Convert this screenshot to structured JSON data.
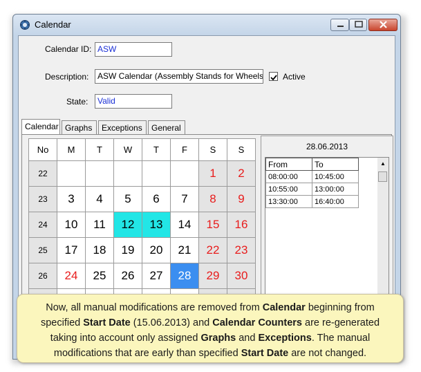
{
  "window": {
    "title": "Calendar"
  },
  "form": {
    "calendar_id_label": "Calendar ID:",
    "calendar_id_value": "ASW",
    "description_label": "Description:",
    "description_value": "ASW Calendar (Assembly Stands for Wheels)",
    "active_label": "Active",
    "active_checked": true,
    "state_label": "State:",
    "state_value": "Valid"
  },
  "tabs": [
    "Calendar",
    "Graphs",
    "Exceptions",
    "General"
  ],
  "calendar": {
    "headers": [
      "No",
      "M",
      "T",
      "W",
      "T",
      "F",
      "S",
      "S"
    ],
    "weeks": [
      {
        "no": "22",
        "days": [
          "",
          "",
          "",
          "",
          "",
          "1",
          "2"
        ]
      },
      {
        "no": "23",
        "days": [
          "3",
          "4",
          "5",
          "6",
          "7",
          "8",
          "9"
        ]
      },
      {
        "no": "24",
        "days": [
          "10",
          "11",
          "12",
          "13",
          "14",
          "15",
          "16"
        ]
      },
      {
        "no": "25",
        "days": [
          "17",
          "18",
          "19",
          "20",
          "21",
          "22",
          "23"
        ]
      },
      {
        "no": "26",
        "days": [
          "24",
          "25",
          "26",
          "27",
          "28",
          "29",
          "30"
        ]
      }
    ]
  },
  "schedule": {
    "date": "28.06.2013",
    "from_header": "From",
    "to_header": "To",
    "rows": [
      {
        "from": "08:00:00",
        "to": "10:45:00"
      },
      {
        "from": "10:55:00",
        "to": "13:00:00"
      },
      {
        "from": "13:30:00",
        "to": "16:40:00"
      }
    ]
  },
  "callout": {
    "t1": "Now, all manual modifications are removed from ",
    "b1": "Calendar",
    "t2": " beginning from specified ",
    "b2": "Start Date",
    "t3": " (15.06.2013) and ",
    "b3": "Calendar Counters",
    "t4": " are re-generated taking into account only assigned ",
    "b4": "Graphs",
    "t5": " and ",
    "b5": "Exceptions",
    "t6": ". The manual modifications that are early than specified ",
    "b6": "Start Date",
    "t7": " are not changed."
  },
  "colors": {
    "weekend": "#e81c1c",
    "highlight": "#22e6e6",
    "selected": "#3b8ef0",
    "callout_bg": "#fbf6bd"
  },
  "icons": {
    "app": "calendar-app-icon",
    "min": "minimize-icon",
    "max": "maximize-icon",
    "close": "close-icon"
  }
}
